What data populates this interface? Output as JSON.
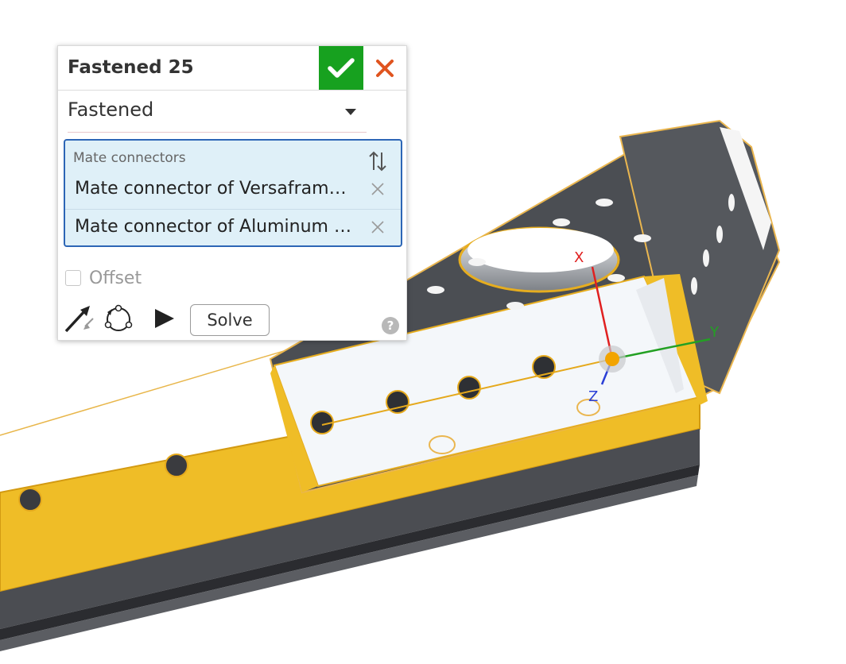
{
  "dialog": {
    "title": "Fastened 25",
    "accept_icon": "check-icon",
    "cancel_icon": "close-icon",
    "mate_type": "Fastened",
    "query": {
      "label": "Mate connectors",
      "items": [
        "Mate connector of Versafram…",
        "Mate connector of Aluminum …"
      ]
    },
    "offset_label": "Offset",
    "offset_checked": false,
    "solve_label": "Solve"
  },
  "triad": {
    "x_label": "X",
    "y_label": "Y",
    "z_label": "Z"
  },
  "colors": {
    "accept_green": "#17a11f",
    "cancel_red": "#e0541f",
    "selection_yellow": "#f0bd23",
    "query_blue": "#2d66b6",
    "query_bg": "#dff0f8",
    "part_dark": "#4a4c50"
  }
}
